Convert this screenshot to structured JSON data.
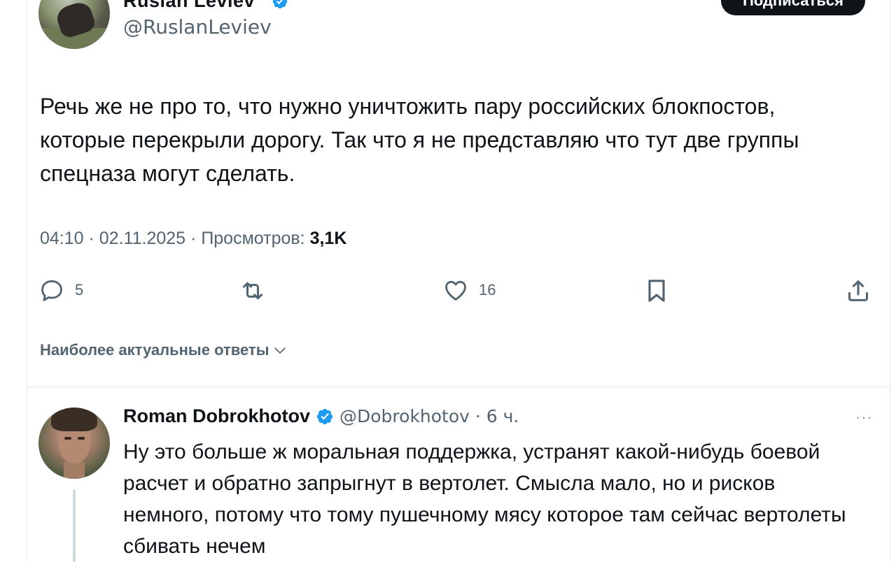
{
  "author": {
    "name": "Ruslan Leviev",
    "handle": "@RuslanLeviev",
    "subscribe_label": "Подписаться"
  },
  "tweet": {
    "text": "Речь же не про то, что нужно уничтожить пару российских блокпостов, которые перекрыли дорогу. Так что я не представляю что тут две группы спецназа могут сделать.",
    "time": "04:10",
    "date": "02.11.2025",
    "views_label": "Просмотров:",
    "views_count": "3,1K"
  },
  "actions": {
    "replies": "5",
    "likes": "16"
  },
  "sort": {
    "label": "Наиболее актуальные ответы"
  },
  "reply": {
    "name": "Roman Dobrokhotov",
    "handle": "@Dobrokhotov",
    "age": "6 ч.",
    "more": "···",
    "text": "Ну это больше ж моральная поддержка, устранят какой-нибудь боевой расчет и обратно запрыгнут в вертолет. Смысла мало, но и рисков немного, потому что тому пушечному мясу которое там сейчас вертолеты сбивать нечем"
  },
  "colors": {
    "verified": "#1d9bf0",
    "secondary_text": "#536471",
    "primary_text": "#0f1419"
  }
}
